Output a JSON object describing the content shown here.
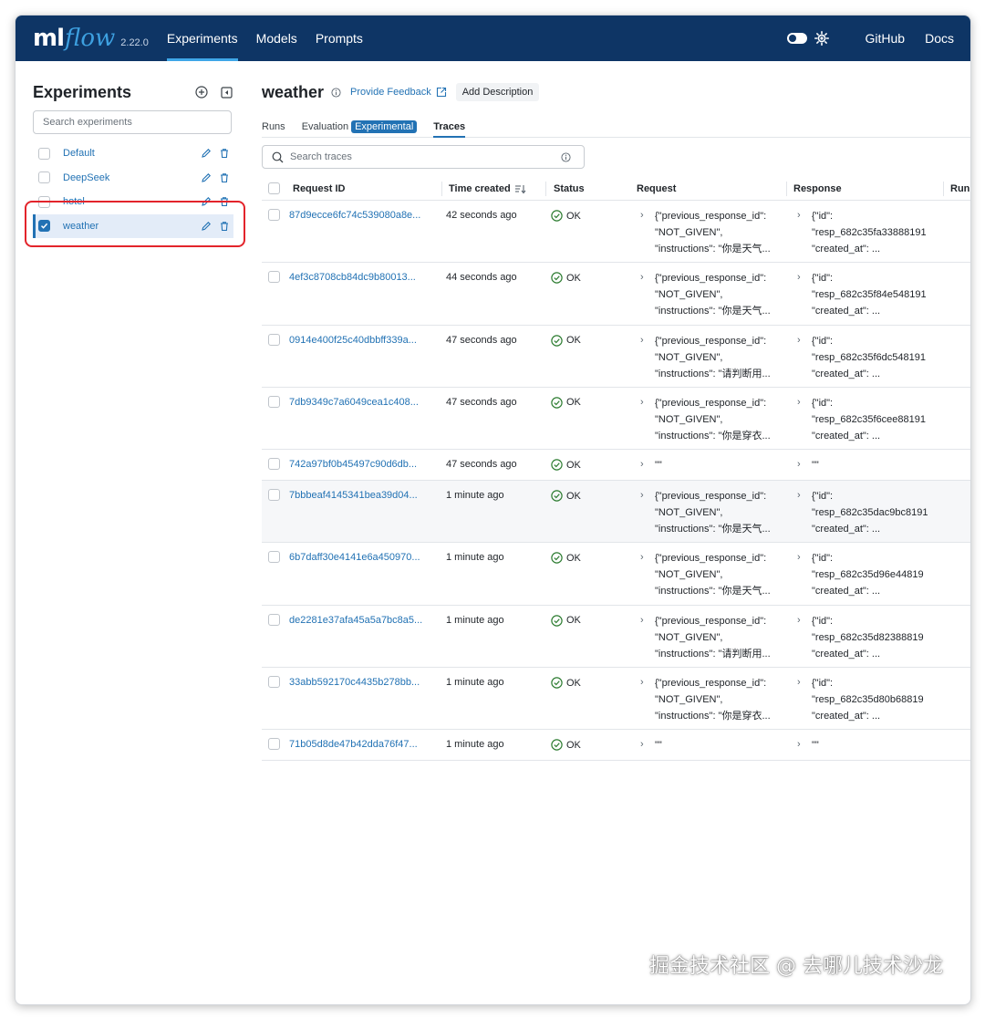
{
  "header": {
    "logo_ml": "ml",
    "logo_flow": "flow",
    "version": "2.22.0",
    "nav": [
      "Experiments",
      "Models",
      "Prompts"
    ],
    "github": "GitHub",
    "docs": "Docs"
  },
  "sidebar": {
    "title": "Experiments",
    "search_placeholder": "Search experiments",
    "items": [
      {
        "name": "Default",
        "checked": false
      },
      {
        "name": "DeepSeek",
        "checked": false
      },
      {
        "name": "hotel",
        "checked": false
      },
      {
        "name": "weather",
        "checked": true
      }
    ]
  },
  "main": {
    "title": "weather",
    "feedback": "Provide Feedback",
    "add_description": "Add Description",
    "tabs": {
      "runs": "Runs",
      "evaluation": "Evaluation",
      "experimental": "Experimental",
      "traces": "Traces"
    },
    "search_placeholder": "Search traces"
  },
  "table": {
    "columns": [
      "Request ID",
      "Time created",
      "Status",
      "Request",
      "Response",
      "Run"
    ],
    "rows": [
      {
        "id": "87d9ecce6fc74c539080a8e...",
        "time": "42 seconds ago",
        "status": "OK",
        "req": [
          "{\"previous_response_id\":",
          "\"NOT_GIVEN\",",
          "\"instructions\": \"你是天气..."
        ],
        "resp": [
          "{\"id\":",
          "\"resp_682c35fa33888191",
          "\"created_at\": ..."
        ]
      },
      {
        "id": "4ef3c8708cb84dc9b80013...",
        "time": "44 seconds ago",
        "status": "OK",
        "req": [
          "{\"previous_response_id\":",
          "\"NOT_GIVEN\",",
          "\"instructions\": \"你是天气..."
        ],
        "resp": [
          "{\"id\":",
          "\"resp_682c35f84e548191",
          "\"created_at\": ..."
        ]
      },
      {
        "id": "0914e400f25c40dbbff339a...",
        "time": "47 seconds ago",
        "status": "OK",
        "req": [
          "{\"previous_response_id\":",
          "\"NOT_GIVEN\",",
          "\"instructions\": \"请判断用..."
        ],
        "resp": [
          "{\"id\":",
          "\"resp_682c35f6dc548191",
          "\"created_at\": ..."
        ]
      },
      {
        "id": "7db9349c7a6049cea1c408...",
        "time": "47 seconds ago",
        "status": "OK",
        "req": [
          "{\"previous_response_id\":",
          "\"NOT_GIVEN\",",
          "\"instructions\": \"你是穿衣..."
        ],
        "resp": [
          "{\"id\":",
          "\"resp_682c35f6cee88191",
          "\"created_at\": ..."
        ]
      },
      {
        "id": "742a97bf0b45497c90d6db...",
        "time": "47 seconds ago",
        "status": "OK",
        "req": [
          "\"\""
        ],
        "resp": [
          "\"\""
        ]
      },
      {
        "id": "7bbbeaf4145341bea39d04...",
        "time": "1 minute ago",
        "status": "OK",
        "req": [
          "{\"previous_response_id\":",
          "\"NOT_GIVEN\",",
          "\"instructions\": \"你是天气..."
        ],
        "resp": [
          "{\"id\":",
          "\"resp_682c35dac9bc8191",
          "\"created_at\": ..."
        ]
      },
      {
        "id": "6b7daff30e4141e6a450970...",
        "time": "1 minute ago",
        "status": "OK",
        "req": [
          "{\"previous_response_id\":",
          "\"NOT_GIVEN\",",
          "\"instructions\": \"你是天气..."
        ],
        "resp": [
          "{\"id\":",
          "\"resp_682c35d96e44819",
          "\"created_at\": ..."
        ]
      },
      {
        "id": "de2281e37afa45a5a7bc8a5...",
        "time": "1 minute ago",
        "status": "OK",
        "req": [
          "{\"previous_response_id\":",
          "\"NOT_GIVEN\",",
          "\"instructions\": \"请判断用..."
        ],
        "resp": [
          "{\"id\":",
          "\"resp_682c35d82388819",
          "\"created_at\": ..."
        ]
      },
      {
        "id": "33abb592170c4435b278bb...",
        "time": "1 minute ago",
        "status": "OK",
        "req": [
          "{\"previous_response_id\":",
          "\"NOT_GIVEN\",",
          "\"instructions\": \"你是穿衣..."
        ],
        "resp": [
          "{\"id\":",
          "\"resp_682c35d80b68819",
          "\"created_at\": ..."
        ]
      },
      {
        "id": "71b05d8de47b42dda76f47...",
        "time": "1 minute ago",
        "status": "OK",
        "req": [
          "\"\""
        ],
        "resp": [
          "\"\""
        ]
      }
    ]
  },
  "watermark": "掘金技术社区 @ 去哪儿技术沙龙",
  "colors": {
    "nav_bg": "#0e3565",
    "link": "#2272b4",
    "ok": "#2e7d32",
    "highlight": "#e3242b"
  }
}
